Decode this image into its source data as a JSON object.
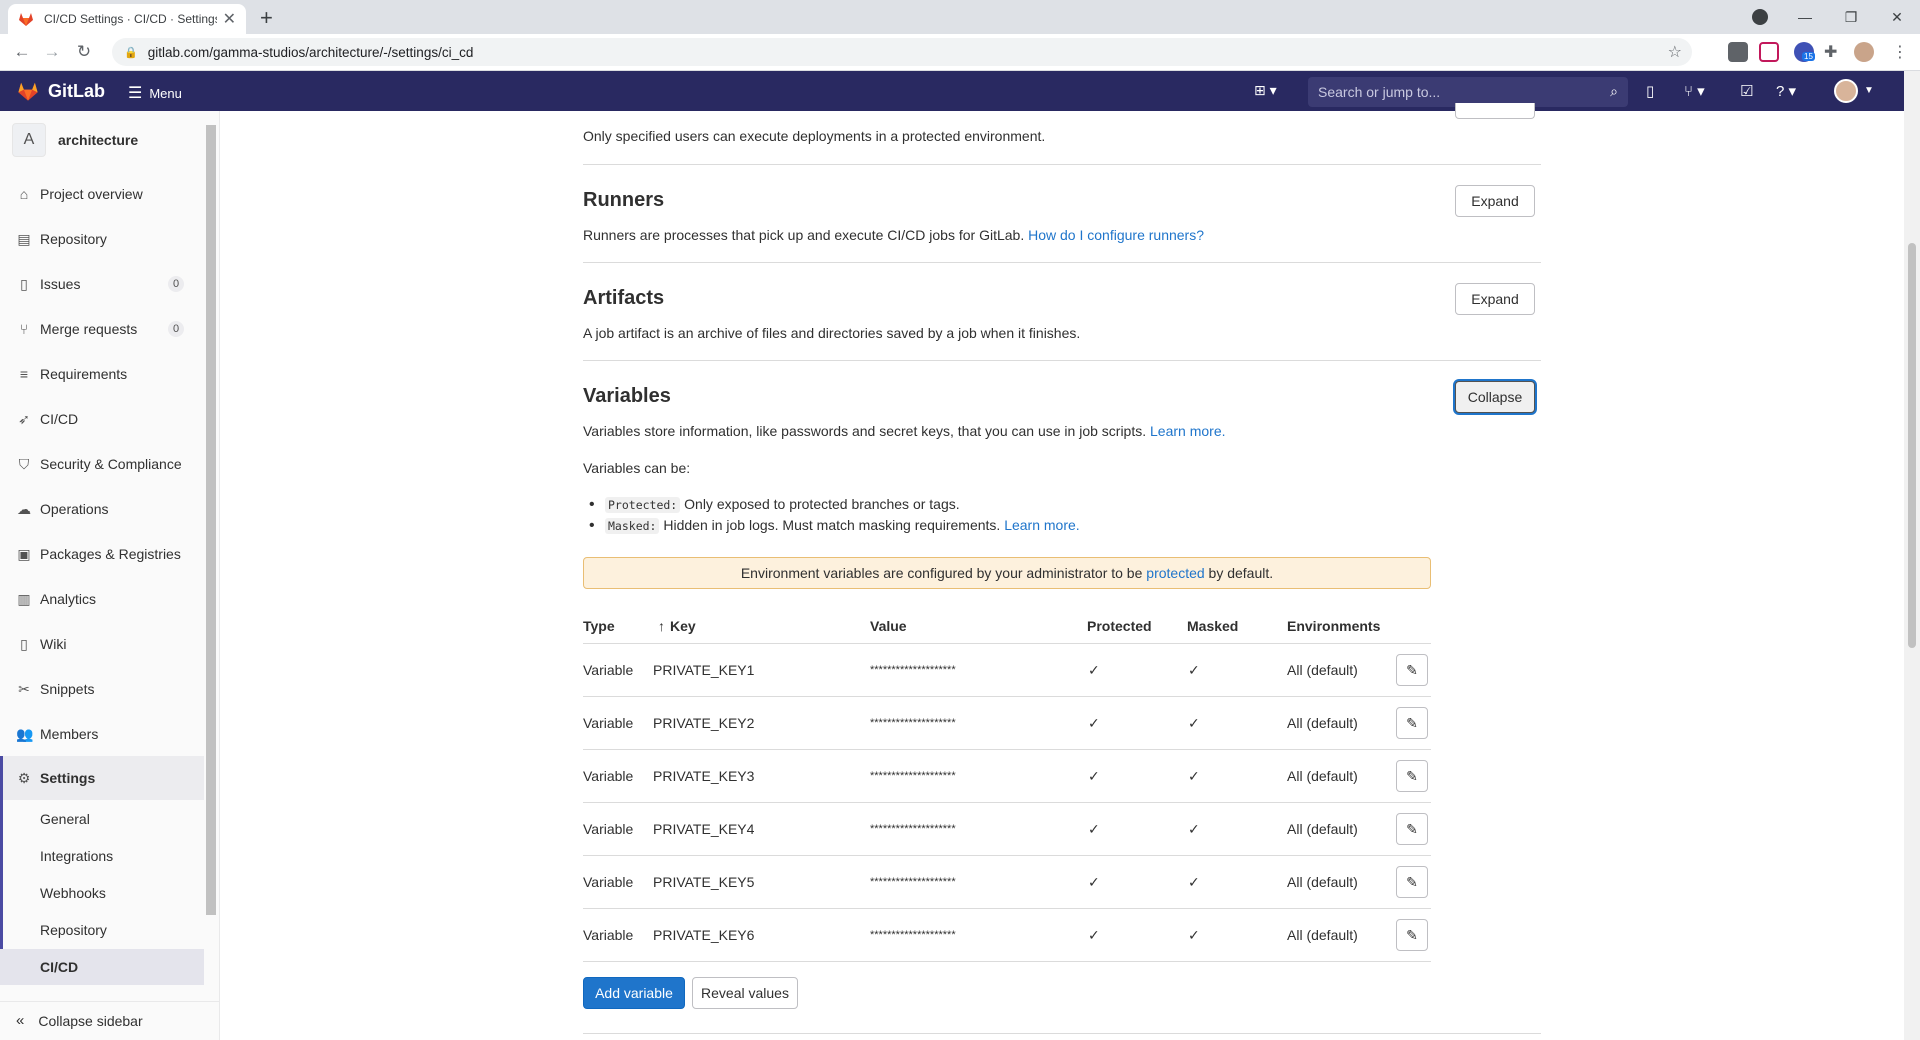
{
  "browser": {
    "tab_title": "CI/CD Settings · CI/CD · Settings",
    "url": "gitlab.com/gamma-studios/architecture/-/settings/ci_cd",
    "extension_badge": "15"
  },
  "header": {
    "brand": "GitLab",
    "menu_label": "Menu",
    "search_placeholder": "Search or jump to..."
  },
  "sidebar": {
    "project_initial": "A",
    "project_name": "architecture",
    "items": [
      {
        "label": "Project overview",
        "icon": "home-icon"
      },
      {
        "label": "Repository",
        "icon": "document-icon"
      },
      {
        "label": "Issues",
        "icon": "issues-icon",
        "count": "0"
      },
      {
        "label": "Merge requests",
        "icon": "merge-request-icon",
        "count": "0"
      },
      {
        "label": "Requirements",
        "icon": "requirements-icon"
      },
      {
        "label": "CI/CD",
        "icon": "rocket-icon"
      },
      {
        "label": "Security & Compliance",
        "icon": "shield-icon"
      },
      {
        "label": "Operations",
        "icon": "cloud-icon"
      },
      {
        "label": "Packages & Registries",
        "icon": "package-icon"
      },
      {
        "label": "Analytics",
        "icon": "chart-icon"
      },
      {
        "label": "Wiki",
        "icon": "book-icon"
      },
      {
        "label": "Snippets",
        "icon": "scissors-icon"
      },
      {
        "label": "Members",
        "icon": "users-icon"
      }
    ],
    "settings_label": "Settings",
    "settings_sub": [
      "General",
      "Integrations",
      "Webhooks",
      "Repository",
      "CI/CD"
    ],
    "collapse_label": "Collapse sidebar"
  },
  "main": {
    "protected_env_desc": "Only specified users can execute deployments in a protected environment.",
    "runners": {
      "title": "Runners",
      "desc": "Runners are processes that pick up and execute CI/CD jobs for GitLab.",
      "link": "How do I configure runners?",
      "button": "Expand"
    },
    "artifacts": {
      "title": "Artifacts",
      "desc": "A job artifact is an archive of files and directories saved by a job when it finishes.",
      "button": "Expand"
    },
    "variables": {
      "title": "Variables",
      "desc": "Variables store information, like passwords and secret keys, that you can use in job scripts.",
      "learn_more": "Learn more.",
      "button": "Collapse",
      "can_be": "Variables can be:",
      "protected_code": "Protected:",
      "protected_text": "Only exposed to protected branches or tags.",
      "masked_code": "Masked:",
      "masked_text": "Hidden in job logs. Must match masking requirements.",
      "alert_pre": "Environment variables are configured by your administrator to be",
      "alert_link": "protected",
      "alert_post": "by default.",
      "columns": {
        "type": "Type",
        "key": "Key",
        "value": "Value",
        "protected": "Protected",
        "masked": "Masked",
        "environments": "Environments"
      },
      "rows": [
        {
          "type": "Variable",
          "key": "PRIVATE_KEY1",
          "value": "********************",
          "env": "All (default)"
        },
        {
          "type": "Variable",
          "key": "PRIVATE_KEY2",
          "value": "********************",
          "env": "All (default)"
        },
        {
          "type": "Variable",
          "key": "PRIVATE_KEY3",
          "value": "********************",
          "env": "All (default)"
        },
        {
          "type": "Variable",
          "key": "PRIVATE_KEY4",
          "value": "********************",
          "env": "All (default)"
        },
        {
          "type": "Variable",
          "key": "PRIVATE_KEY5",
          "value": "********************",
          "env": "All (default)"
        },
        {
          "type": "Variable",
          "key": "PRIVATE_KEY6",
          "value": "********************",
          "env": "All (default)"
        }
      ],
      "add_button": "Add variable",
      "reveal_button": "Reveal values"
    }
  },
  "colors": {
    "header_bg": "#292961",
    "primary": "#1f75cb",
    "alert_bg": "#fdf1dd"
  }
}
